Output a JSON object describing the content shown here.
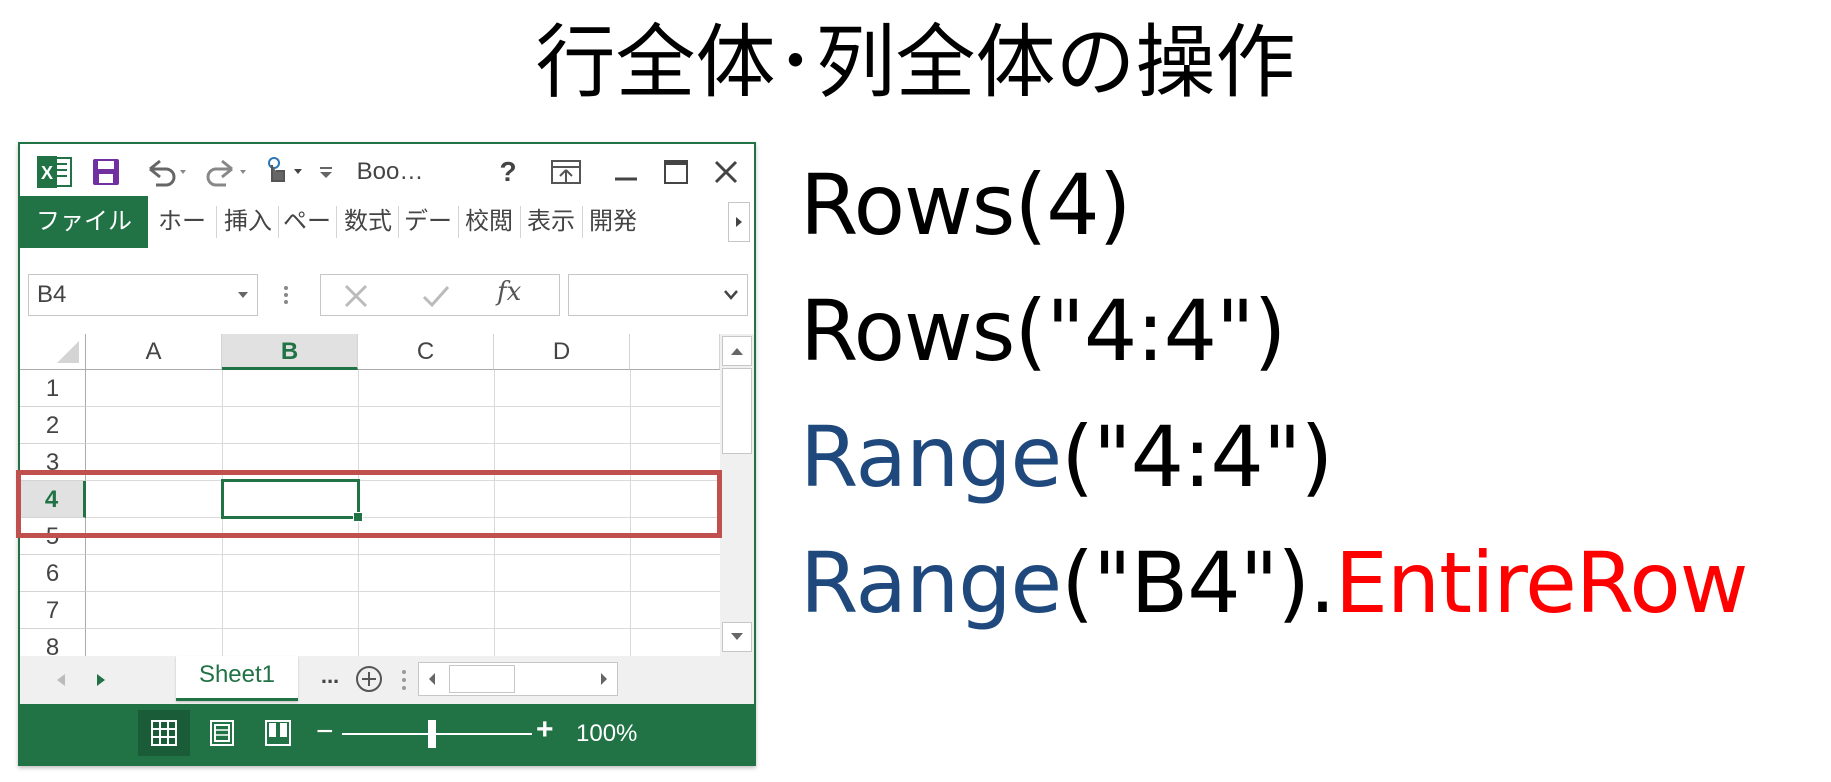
{
  "slide": {
    "title": "行全体･列全体の操作",
    "code_lines": [
      {
        "parts": [
          {
            "text": "Rows(4)",
            "color": "#000000"
          }
        ]
      },
      {
        "parts": [
          {
            "text": "Rows(\"4:4\")",
            "color": "#000000"
          }
        ]
      },
      {
        "parts": [
          {
            "text": "Range",
            "color": "#1f497d"
          },
          {
            "text": "(\"4:4\")",
            "color": "#000000"
          }
        ]
      },
      {
        "parts": [
          {
            "text": "Range",
            "color": "#1f497d"
          },
          {
            "text": "(\"B4\").",
            "color": "#000000"
          },
          {
            "text": "EntireRow",
            "color": "#ff0000"
          }
        ]
      }
    ]
  },
  "excel": {
    "accent": "#217346",
    "highlight_color": "#c0504d",
    "title_short": "Boo…",
    "help_glyph": "?",
    "tabs": {
      "file": "ファイル",
      "items": [
        "ホー",
        "挿入",
        "ペー",
        "数式",
        "デー",
        "校閲",
        "表示",
        "開発"
      ]
    },
    "name_box": "B4",
    "fx_label": "fx",
    "columns": [
      "A",
      "B",
      "C",
      "D"
    ],
    "rows": [
      "1",
      "2",
      "3",
      "4",
      "5",
      "6",
      "7",
      "8"
    ],
    "active_cell": "B4",
    "sheet_tab": "Sheet1",
    "sheet_more": "...",
    "zoom": "100%",
    "zoom_minus": "−",
    "zoom_plus": "+"
  }
}
